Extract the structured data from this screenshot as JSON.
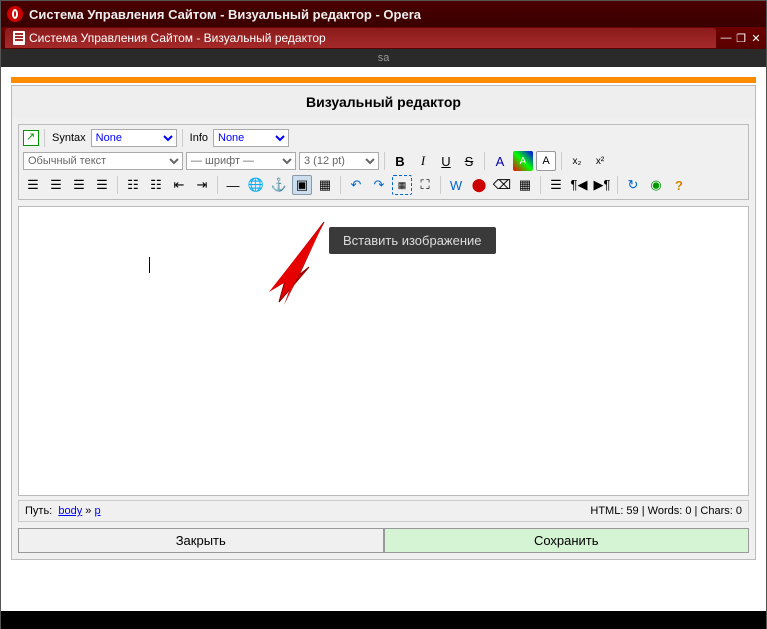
{
  "browser": {
    "title": "Система Управления Сайтом - Визуальный редактор - Opera",
    "tab_title": "Система Управления Сайтом - Визуальный редактор",
    "status": "sa"
  },
  "editor": {
    "title": "Визуальный редактор",
    "syntax_label": "Syntax",
    "syntax_value": "None",
    "info_label": "Info",
    "info_value": "None",
    "format_value": "Обычный текст",
    "font_value": "— шрифт —",
    "size_value": "3 (12 pt)",
    "tooltip": "Вставить изображение",
    "path_label": "Путь:",
    "path_body": "body",
    "path_sep": "»",
    "path_p": "p",
    "stats": "HTML: 59 | Words: 0 | Chars: 0",
    "close_btn": "Закрыть",
    "save_btn": "Сохранить"
  }
}
